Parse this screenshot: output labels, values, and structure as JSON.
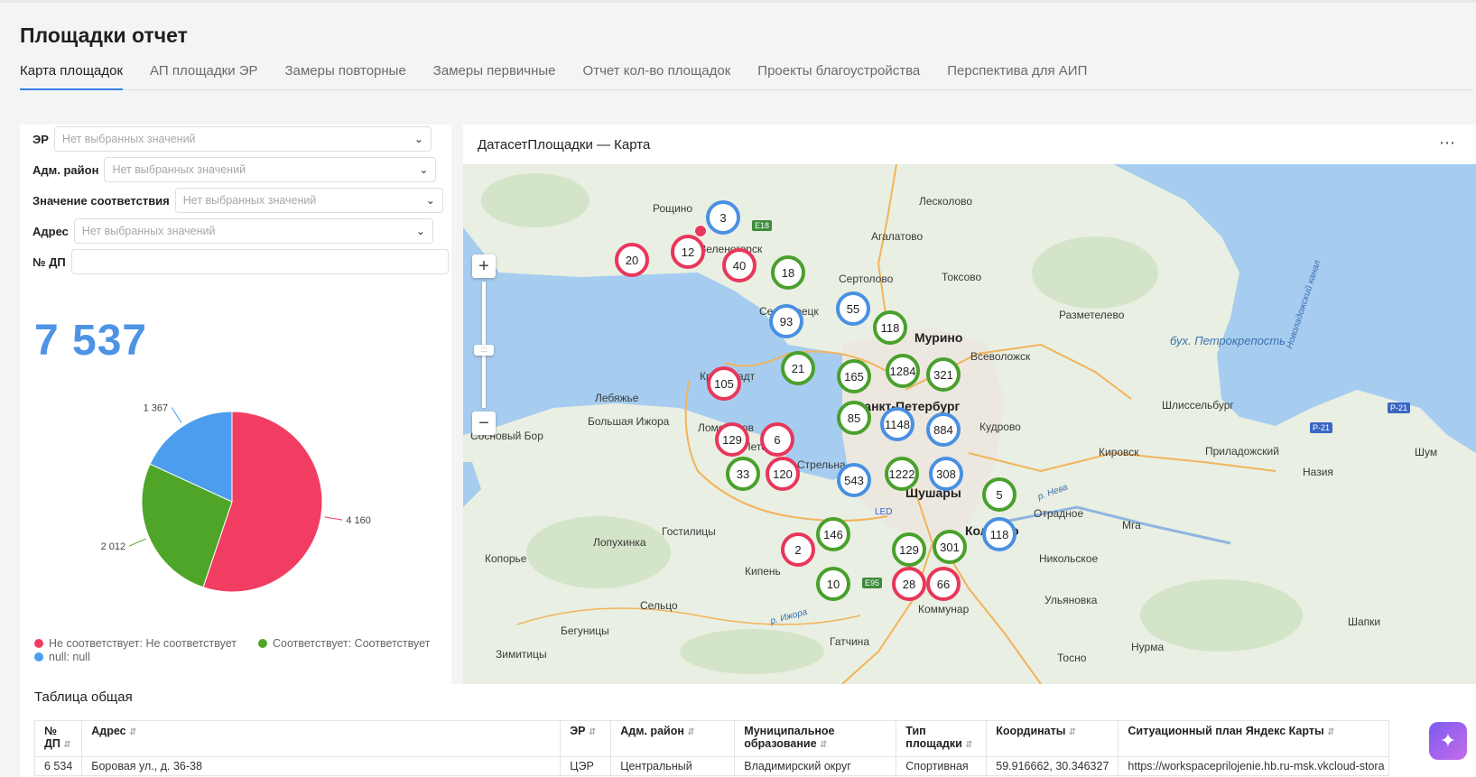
{
  "page": {
    "title": "Площадки отчет"
  },
  "tabs": [
    {
      "label": "Карта площадок"
    },
    {
      "label": "АП площадки ЭР"
    },
    {
      "label": "Замеры повторные"
    },
    {
      "label": "Замеры первичные"
    },
    {
      "label": "Отчет кол-во площадок"
    },
    {
      "label": "Проекты благоустройства"
    },
    {
      "label": "Перспектива для АИП"
    }
  ],
  "filters": {
    "er": {
      "label": "ЭР",
      "placeholder": "Нет выбранных значений"
    },
    "district": {
      "label": "Адм. район",
      "placeholder": "Нет выбранных значений"
    },
    "compliance": {
      "label": "Значение соответствия",
      "placeholder": "Нет выбранных значений"
    },
    "address": {
      "label": "Адрес",
      "placeholder": "Нет выбранных значений"
    },
    "dp": {
      "label": "№ ДП",
      "value": ""
    }
  },
  "total": {
    "value": "7 537"
  },
  "chart_data": {
    "type": "pie",
    "slices": [
      {
        "label": "Не соответствует: Не соответствует",
        "value": 4160,
        "display": "4 160",
        "color": "#f23d63"
      },
      {
        "label": "Соответствует: Соответствует",
        "value": 2012,
        "display": "2 012",
        "color": "#4ea528"
      },
      {
        "label": "null: null",
        "value": 1367,
        "display": "1 367",
        "color": "#4c9ded"
      }
    ],
    "legend_placement": "bottom"
  },
  "map": {
    "title": "ДатасетПлощадки — Карта",
    "more_icon": "ellipsis-icon",
    "clusters": [
      {
        "label": "3",
        "color": "blue"
      },
      {
        "label": "20",
        "color": "red"
      },
      {
        "label": "12",
        "color": "red"
      },
      {
        "label": "40",
        "color": "red"
      },
      {
        "label": "18",
        "color": "red"
      },
      {
        "label": "55",
        "color": "blue"
      },
      {
        "label": "93",
        "color": "red"
      },
      {
        "label": "118",
        "color": "red"
      },
      {
        "label": "105",
        "color": "red"
      },
      {
        "label": "21",
        "color": "red"
      },
      {
        "label": "165",
        "color": "red"
      },
      {
        "label": "1284",
        "color": "red"
      },
      {
        "label": "321",
        "color": "red"
      },
      {
        "label": "85",
        "color": "red"
      },
      {
        "label": "1148",
        "color": "red"
      },
      {
        "label": "884",
        "color": "red"
      },
      {
        "label": "129",
        "color": "red"
      },
      {
        "label": "6",
        "color": "red"
      },
      {
        "label": "33",
        "color": "green"
      },
      {
        "label": "120",
        "color": "red"
      },
      {
        "label": "543",
        "color": "red"
      },
      {
        "label": "1222",
        "color": "red"
      },
      {
        "label": "308",
        "color": "red"
      },
      {
        "label": "5",
        "color": "red"
      },
      {
        "label": "146",
        "color": "red"
      },
      {
        "label": "2",
        "color": "red"
      },
      {
        "label": "129",
        "color": "red"
      },
      {
        "label": "301",
        "color": "green"
      },
      {
        "label": "118",
        "color": "blue"
      },
      {
        "label": "10",
        "color": "red"
      },
      {
        "label": "28",
        "color": "red"
      },
      {
        "label": "66",
        "color": "red"
      }
    ],
    "places": [
      "Рощино",
      "Лесколово",
      "Агалатово",
      "Зеленогорск",
      "Сестрорецк",
      "Сертолово",
      "Токсово",
      "Мурино",
      "Всеволожск",
      "Разметелево",
      "Кронштадт",
      "Лебяжье",
      "Большая Ижора",
      "Санкт-Петербург",
      "Шлиссельбург",
      "Сосновый Бор",
      "Ломоносов",
      "Петергоф",
      "Стрельна",
      "Шушары",
      "Отрадное",
      "Кировск",
      "Приладожский",
      "Шум",
      "Назия",
      "Мга",
      "Колпино",
      "Никольское",
      "Гостилицы",
      "Лопухинка",
      "Копорье",
      "Кипень",
      "Сельцо",
      "Ульяновка",
      "Коммунар",
      "Бегуницы",
      "Шапки",
      "Гатчина",
      "Кудрово",
      "Зимитицы",
      "Нурма",
      "Тосно"
    ],
    "water": [
      "бух. Петрокрепость",
      "Новоладожский канал",
      "р. Нева",
      "р. Ижора"
    ],
    "roads": [
      "E18",
      "E95",
      "P-21",
      "P-21"
    ],
    "airport": "LED"
  },
  "table": {
    "title": "Таблица общая",
    "columns": [
      "№ ДП",
      "Адрес",
      "ЭР",
      "Адм. район",
      "Муниципальное образование",
      "Тип площадки",
      "Координаты",
      "Ситуационный план Яндекс Карты"
    ],
    "rows": [
      [
        "6 534",
        "Боровая ул., д. 36-38",
        "ЦЭР",
        "Центральный",
        "Владимирский округ",
        "Спортивная",
        "59.916662, 30.346327",
        "https://workspaceprilojenie.hb.ru-msk.vkcloud-stora"
      ]
    ]
  }
}
